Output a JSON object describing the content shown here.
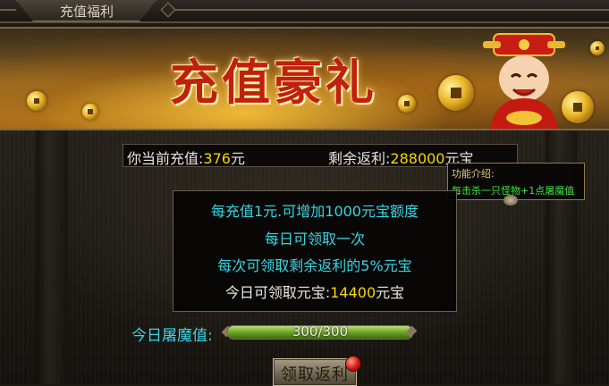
{
  "window": {
    "tab_title": "充值福利"
  },
  "banner": {
    "title": "充值豪礼"
  },
  "info_bar": {
    "current_label": "你当前充值:",
    "current_value": "376",
    "current_unit": "元",
    "remaining_label": "剩余返利:",
    "remaining_value": "288000",
    "remaining_unit": "元宝"
  },
  "tooltip": {
    "title": "功能介绍:",
    "text": "每击杀一只怪物+1点屠魔值"
  },
  "info_box": {
    "line1": "每充值1元.可增加1000元宝额度",
    "line2": "每日可领取一次",
    "line3": "每次可领取剩余返利的5%元宝",
    "line4_label": "今日可领取元宝:",
    "line4_value": "14400",
    "line4_unit": "元宝"
  },
  "progress": {
    "label": "今日屠魔值:",
    "text": "300/300",
    "fraction": 1.0
  },
  "claim_button": {
    "label": "领取返利"
  },
  "colors": {
    "highlight_yellow": "#f5d800",
    "cyan_text": "#38d6e4",
    "tooltip_green": "#3fe23f"
  }
}
